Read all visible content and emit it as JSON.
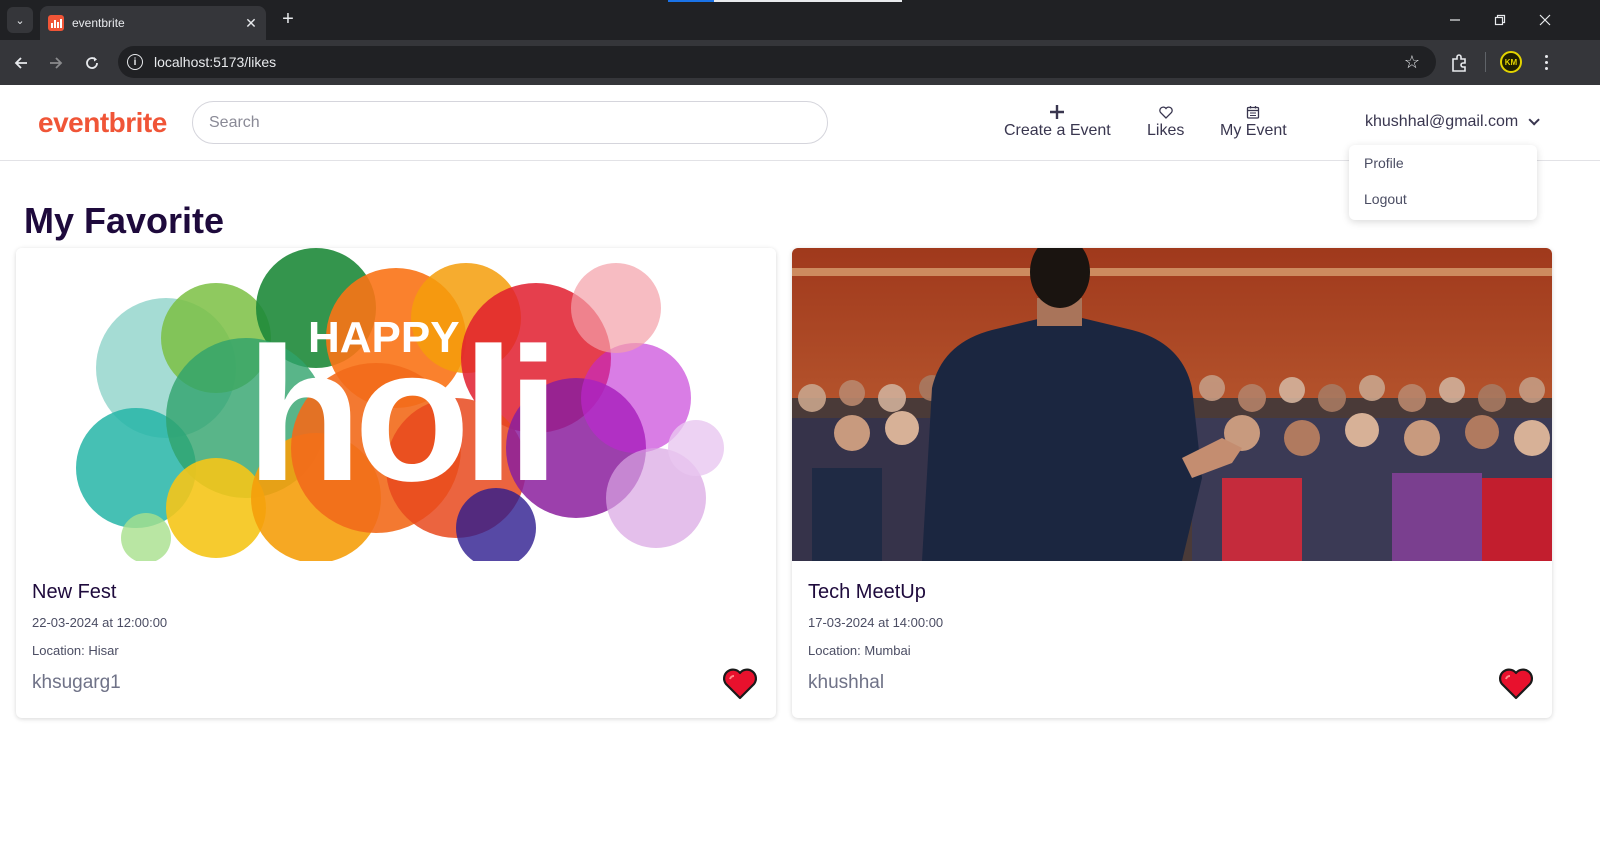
{
  "browser": {
    "tab_title": "eventbrite",
    "url": "localhost:5173/likes"
  },
  "header": {
    "logo": "eventbrite",
    "search_placeholder": "Search",
    "nav": {
      "create": "Create a Event",
      "likes": "Likes",
      "my_event": "My Event"
    },
    "user_email": "khushhal@gmail.com",
    "dropdown": {
      "profile": "Profile",
      "logout": "Logout"
    }
  },
  "page": {
    "title": "My Favorite"
  },
  "events": [
    {
      "title": "New Fest",
      "datetime": "22-03-2024 at 12:00:00",
      "location": "Location: Hisar",
      "author": "khsugarg1",
      "image_text_top": "HAPPY",
      "image_text_main": "holi",
      "liked": true
    },
    {
      "title": "Tech MeetUp",
      "datetime": "17-03-2024 at 14:00:00",
      "location": "Location: Mumbai",
      "author": "khushhal",
      "liked": true
    }
  ],
  "colors": {
    "brand": "#f05537",
    "heart": "#e8112d",
    "title": "#1e0a3c"
  }
}
